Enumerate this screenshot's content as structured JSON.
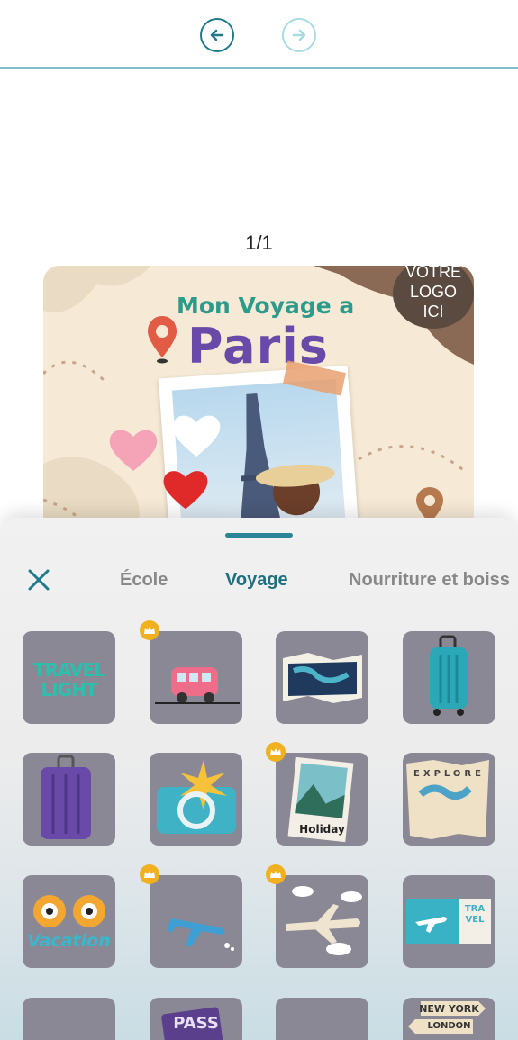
{
  "toolbar": {
    "undo_icon": "undo-arrow-icon",
    "redo_icon": "redo-arrow-icon"
  },
  "canvas": {
    "page_indicator": "1/1",
    "card": {
      "subtitle": "Mon Voyage a",
      "title": "Paris",
      "logo_placeholder": [
        "VOTRE",
        "LOGO",
        "ICI"
      ]
    }
  },
  "sheet": {
    "close_icon": "close-icon",
    "tabs": [
      {
        "label": "École",
        "active": false
      },
      {
        "label": "Voyage",
        "active": true
      },
      {
        "label": "Nourriture et boiss",
        "active": false
      }
    ],
    "stickers": [
      {
        "name": "travel-light-sticker",
        "text": "TRAVEL LIGHT",
        "premium": false
      },
      {
        "name": "bus-sticker",
        "text": "",
        "premium": true
      },
      {
        "name": "map-sticker",
        "text": "",
        "premium": false
      },
      {
        "name": "teal-suitcase-sticker",
        "text": "",
        "premium": false
      },
      {
        "name": "purple-suitcase-sticker",
        "text": "",
        "premium": false
      },
      {
        "name": "sun-suitcase-sticker",
        "text": "",
        "premium": false
      },
      {
        "name": "holiday-photo-sticker",
        "text": "Holiday",
        "premium": true
      },
      {
        "name": "explore-map-sticker",
        "text": "EXPLORE",
        "premium": false
      },
      {
        "name": "vacation-glasses-sticker",
        "text": "Vacation",
        "premium": false
      },
      {
        "name": "airplane-blue-sticker",
        "text": "",
        "premium": true
      },
      {
        "name": "airplane-clouds-sticker",
        "text": "",
        "premium": true
      },
      {
        "name": "travel-ticket-sticker",
        "text": "TRA VEL",
        "premium": false
      },
      {
        "name": "partial-sticker-1",
        "text": "",
        "premium": false
      },
      {
        "name": "passport-sticker",
        "text": "PASS",
        "premium": false
      },
      {
        "name": "partial-sticker-3",
        "text": "",
        "premium": false
      },
      {
        "name": "signpost-sticker",
        "text": "NEW YORK LONDON",
        "premium": false
      }
    ],
    "sign_top": "NEW YORK",
    "sign_bottom": "LONDON"
  },
  "colors": {
    "accent": "#1f7a8c",
    "tile": "#8b8896",
    "crown": "#f0b020"
  }
}
